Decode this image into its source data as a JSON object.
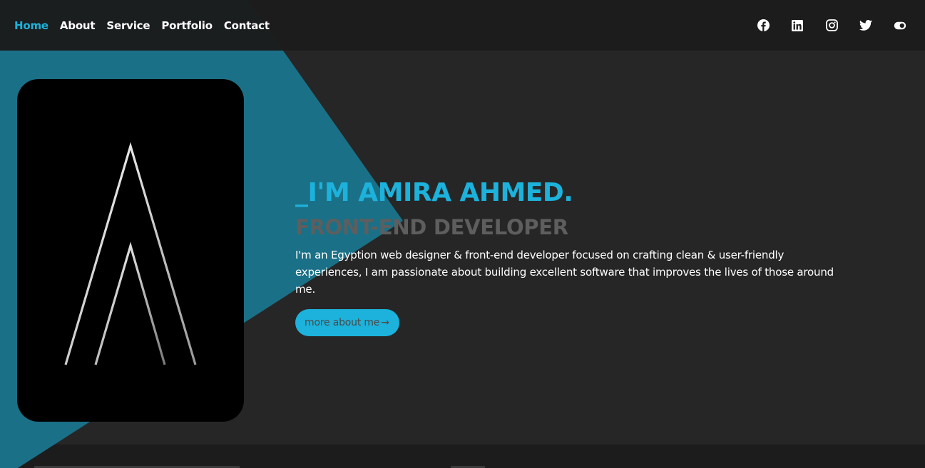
{
  "nav": {
    "links": [
      {
        "label": "Home",
        "active": true
      },
      {
        "label": "About",
        "active": false
      },
      {
        "label": "Service",
        "active": false
      },
      {
        "label": "Portfolio",
        "active": false
      },
      {
        "label": "Contact",
        "active": false
      }
    ],
    "social_icons": [
      "facebook-icon",
      "linkedin-icon",
      "instagram-icon",
      "twitter-icon",
      "theme-toggle-icon"
    ]
  },
  "hero": {
    "name": "_I'M AMIRA AHMED.",
    "role": "FRONT-END DEVELOPER",
    "description": "I'm an Egyption web designer & front-end developer focused on crafting clean & user-friendly experiences, I am passionate about building excellent software that improves the lives of those around me.",
    "button_label": "more about me",
    "button_arrow": "→"
  },
  "colors": {
    "accent": "#1cb2dc",
    "teal_bg": "#1a7087",
    "navbar": "#1c1c1c",
    "page_bg": "#262626",
    "role_text": "#5e5e5e"
  }
}
